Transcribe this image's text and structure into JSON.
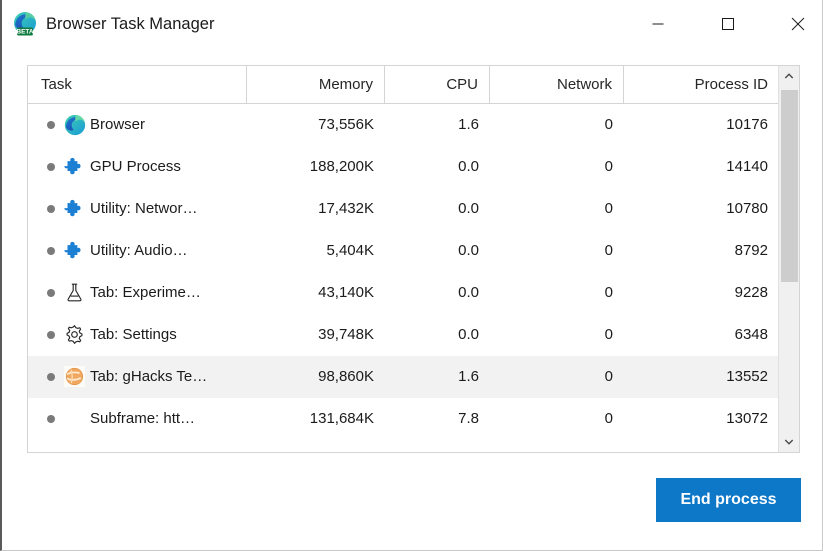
{
  "window": {
    "title": "Browser Task Manager",
    "app_icon": "edge-beta-logo",
    "controls": {
      "minimize": "Minimize",
      "maximize": "Maximize",
      "close": "Close"
    }
  },
  "table": {
    "columns": [
      {
        "key": "task",
        "label": "Task",
        "align": "left"
      },
      {
        "key": "memory",
        "label": "Memory",
        "align": "right"
      },
      {
        "key": "cpu",
        "label": "CPU",
        "align": "right"
      },
      {
        "key": "network",
        "label": "Network",
        "align": "right"
      },
      {
        "key": "pid",
        "label": "Process ID",
        "align": "right"
      }
    ],
    "rows": [
      {
        "icon": "edge-logo-icon",
        "task": "Browser",
        "memory": "73,556K",
        "cpu": "1.6",
        "network": "0",
        "pid": "10176",
        "selected": false
      },
      {
        "icon": "puzzle-piece-icon",
        "task": "GPU Process",
        "memory": "188,200K",
        "cpu": "0.0",
        "network": "0",
        "pid": "14140",
        "selected": false
      },
      {
        "icon": "puzzle-piece-icon",
        "task": "Utility: Networ…",
        "memory": "17,432K",
        "cpu": "0.0",
        "network": "0",
        "pid": "10780",
        "selected": false
      },
      {
        "icon": "puzzle-piece-icon",
        "task": "Utility: Audio…",
        "memory": "5,404K",
        "cpu": "0.0",
        "network": "0",
        "pid": "8792",
        "selected": false
      },
      {
        "icon": "flask-icon",
        "task": "Tab: Experime…",
        "memory": "43,140K",
        "cpu": "0.0",
        "network": "0",
        "pid": "9228",
        "selected": false
      },
      {
        "icon": "gear-icon",
        "task": "Tab: Settings",
        "memory": "39,748K",
        "cpu": "0.0",
        "network": "0",
        "pid": "6348",
        "selected": false
      },
      {
        "icon": "ghacks-favicon",
        "task": "Tab: gHacks Te…",
        "memory": "98,860K",
        "cpu": "1.6",
        "network": "0",
        "pid": "13552",
        "selected": true
      },
      {
        "icon": "none",
        "task": "Subframe: htt…",
        "memory": "131,684K",
        "cpu": "7.8",
        "network": "0",
        "pid": "13072",
        "selected": false
      }
    ]
  },
  "scrollbar": {
    "up_arrow": "chevron-up-icon",
    "down_arrow": "chevron-down-icon"
  },
  "footer": {
    "end_process_label": "End process"
  },
  "colors": {
    "accent_blue": "#0d77c8",
    "selected_row": "#f2f2f2",
    "border": "#d4d4d4",
    "text": "#1b1b1b",
    "bullet": "#7a7a7a"
  }
}
